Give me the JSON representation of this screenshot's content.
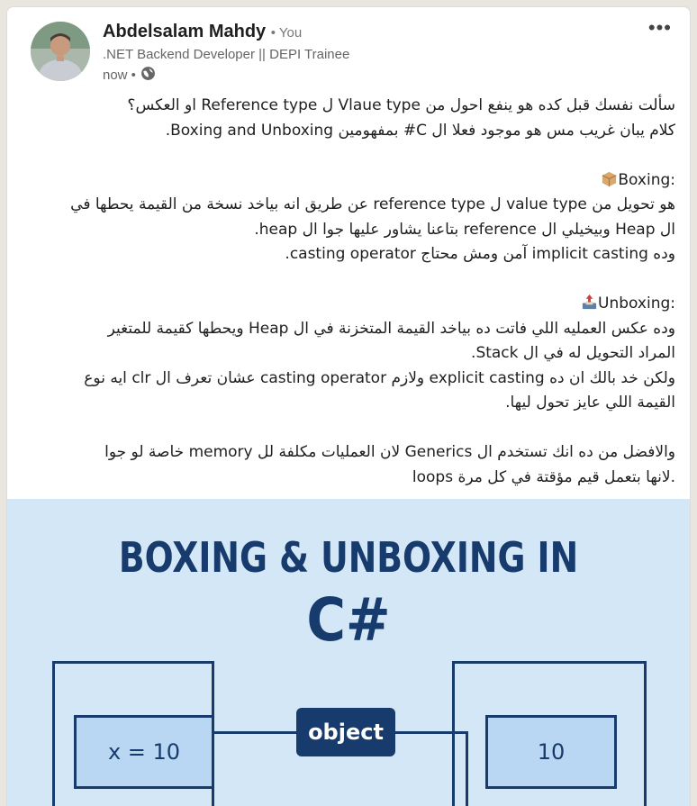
{
  "author": {
    "name": "Abdelsalam Mahdy",
    "relation": "• You",
    "headline": ".NET Backend Developer || DEPI Trainee",
    "time": "now •"
  },
  "icons": {
    "visibility": "globe-icon",
    "menu": "more-horizontal-icon",
    "boxing": "package-icon",
    "unboxing": "outbox-tray-icon"
  },
  "post": {
    "lines": [
      "سألت نفسك قبل كده هو ينفع احول من Vlaue type ل Reference type او العكس؟",
      "كلام يبان غريب مس هو موجود فعلا ال C# بمفهومين Boxing and Unboxing.",
      "",
      "Boxing:",
      "هو تحويل من value type ل reference type عن طريق انه بياخد نسخة من القيمة يحطها في",
      "ال Heap وبيخيلي ال reference بتاعنا يشاور عليها جوا ال heap.",
      "وده implicit casting آمن ومش محتاج casting operator.",
      "",
      "Unboxing:",
      "وده عكس العمليه اللي فاتت ده بياخد القيمة المتخزنة في ال Heap ويحطها كقيمة للمتغير",
      "المراد التحويل له في ال Stack.",
      "ولكن خد بالك ان ده explicit casting ولازم casting operator عشان تعرف ال clr ايه نوع",
      "القيمة اللي عايز تحول ليها.",
      "",
      "والافضل من ده انك تستخدم ال Generics لان العمليات مكلفة لل memory خاصة لو جوا",
      "loops لانها بتعمل قيم مؤقتة في كل مرة."
    ]
  },
  "image": {
    "title_line1": "BOXING & UNBOXING IN",
    "title_line2": "C#",
    "left_value": "x = 10",
    "middle_label": "object",
    "right_value": "10"
  },
  "colors": {
    "image_bg": "#d4e7f7",
    "image_ink": "#163b6c",
    "box_fill": "#b9d7f2"
  }
}
